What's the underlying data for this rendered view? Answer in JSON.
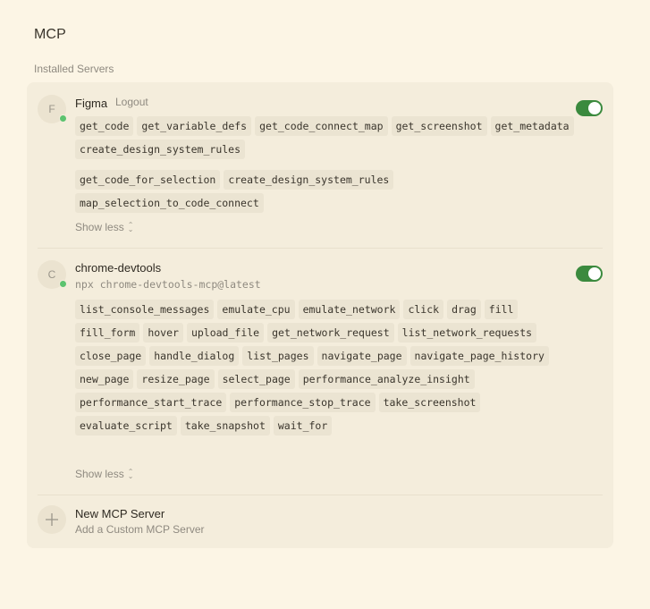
{
  "page": {
    "title": "MCP",
    "section_label": "Installed Servers"
  },
  "servers": [
    {
      "avatar": "F",
      "name": "Figma",
      "action": "Logout",
      "enabled": true,
      "tool_groups": [
        [
          "get_code",
          "get_variable_defs",
          "get_code_connect_map",
          "get_screenshot",
          "get_metadata",
          "create_design_system_rules"
        ],
        [
          "get_code_for_selection",
          "create_design_system_rules",
          "map_selection_to_code_connect"
        ]
      ],
      "show_less": "Show less"
    },
    {
      "avatar": "C",
      "name": "chrome-devtools",
      "command": "npx chrome-devtools-mcp@latest",
      "enabled": true,
      "tool_groups": [
        [
          "list_console_messages",
          "emulate_cpu",
          "emulate_network",
          "click",
          "drag",
          "fill",
          "fill_form",
          "hover",
          "upload_file",
          "get_network_request",
          "list_network_requests",
          "close_page",
          "handle_dialog",
          "list_pages",
          "navigate_page",
          "navigate_page_history",
          "new_page",
          "resize_page",
          "select_page",
          "performance_analyze_insight",
          "performance_start_trace",
          "performance_stop_trace",
          "take_screenshot",
          "evaluate_script",
          "take_snapshot",
          "wait_for"
        ]
      ],
      "show_less": "Show less"
    }
  ],
  "new_server": {
    "title": "New MCP Server",
    "subtitle": "Add a Custom MCP Server",
    "icon": "plus-icon"
  },
  "colors": {
    "background": "#fcf5e5",
    "panel": "#f4eddc",
    "chip": "#ebe4d2",
    "toggle_on": "#3b8a3e",
    "status_online": "#5cc36f"
  }
}
